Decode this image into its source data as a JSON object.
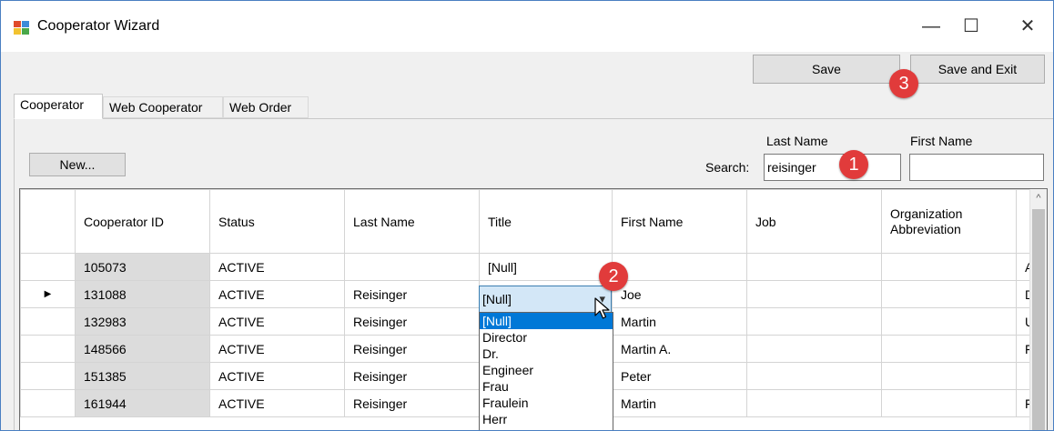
{
  "window": {
    "title": "Cooperator Wizard",
    "minimize_glyph": "—",
    "maximize_glyph": "☐",
    "close_glyph": "✕"
  },
  "toolbar": {
    "save_label": "Save",
    "save_exit_label": "Save and Exit"
  },
  "tabs": [
    {
      "label": "Cooperator",
      "active": true
    },
    {
      "label": "Web Cooperator",
      "active": false
    },
    {
      "label": "Web Order",
      "active": false
    }
  ],
  "search": {
    "new_label": "New...",
    "search_label": "Search:",
    "last_name_label": "Last Name",
    "first_name_label": "First Name",
    "last_name_value": "reisinger",
    "first_name_value": ""
  },
  "badges": {
    "one": "1",
    "two": "2",
    "three": "3",
    "color": "#e13b3b"
  },
  "grid": {
    "columns": [
      "Cooperator ID",
      "Status",
      "Last Name",
      "Title",
      "First Name",
      "Job",
      "Organization Abbreviation",
      ""
    ],
    "rows": [
      {
        "indicator": "",
        "cells": [
          "105073",
          "ACTIVE",
          "",
          "[Null]",
          "",
          "",
          "",
          "A"
        ]
      },
      {
        "indicator": "▶",
        "cells": [
          "131088",
          "ACTIVE",
          "Reisinger",
          "",
          "Joe",
          "",
          "",
          "D"
        ]
      },
      {
        "indicator": "",
        "cells": [
          "132983",
          "ACTIVE",
          "Reisinger",
          "",
          "Martin",
          "",
          "",
          "U"
        ]
      },
      {
        "indicator": "",
        "cells": [
          "148566",
          "ACTIVE",
          "Reisinger",
          "",
          "Martin A.",
          "",
          "",
          "F"
        ]
      },
      {
        "indicator": "",
        "cells": [
          "151385",
          "ACTIVE",
          "Reisinger",
          "",
          "Peter",
          "",
          "",
          ""
        ]
      },
      {
        "indicator": "",
        "cells": [
          "161944",
          "ACTIVE",
          "Reisinger",
          "",
          "Martin",
          "",
          "",
          "F"
        ]
      }
    ],
    "scroll_up_glyph": "^"
  },
  "title_editor": {
    "value": "[Null]",
    "arrow_glyph": "▾",
    "options": [
      "[Null]",
      "Director",
      "Dr.",
      "Engineer",
      "Frau",
      "Fraulein",
      "Herr"
    ],
    "selected": "[Null]"
  },
  "colors": {
    "accent": "#0078d7",
    "combo_bg": "#d3e7f7",
    "badge": "#e13b3b"
  }
}
